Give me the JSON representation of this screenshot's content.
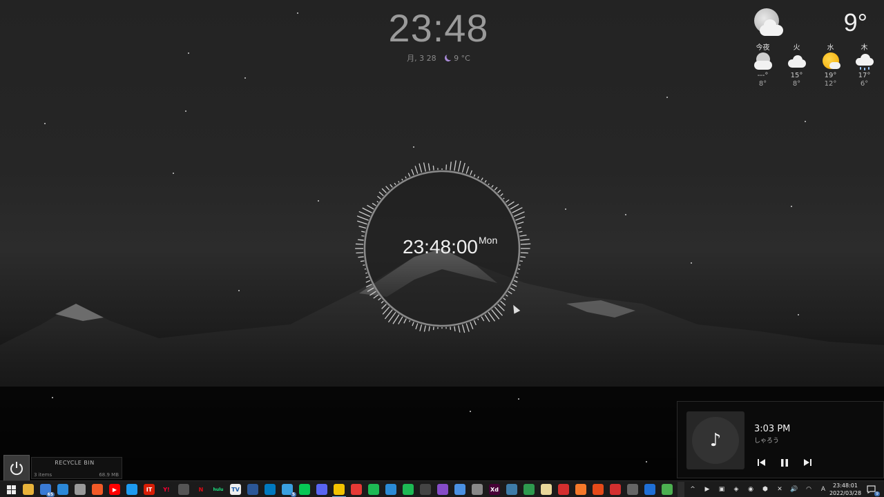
{
  "top_clock": {
    "time": "23:48",
    "date": "月, 3 28",
    "weather": "9 °C"
  },
  "weather": {
    "current_temp": "9°",
    "current_icon": "night-cloud-icon",
    "days": [
      {
        "label": "今夜",
        "icon": "night-cloud-icon",
        "hi": "---°",
        "lo": "8°"
      },
      {
        "label": "火",
        "icon": "cloud-icon",
        "hi": "15°",
        "lo": "8°"
      },
      {
        "label": "水",
        "icon": "sun-cloud-icon",
        "hi": "19°",
        "lo": "12°"
      },
      {
        "label": "木",
        "icon": "rain-cloud-icon",
        "hi": "17°",
        "lo": "6°"
      }
    ]
  },
  "visualizer": {
    "time": "23:48:00",
    "day": "Mon"
  },
  "player": {
    "time": "3:03 PM",
    "artist": "しゃろう",
    "art_icon": "music-note-icon"
  },
  "recycle_bin": {
    "title": "RECYCLE BIN",
    "items": "3 items",
    "size": "68.9 MB"
  },
  "taskbar": {
    "apps": [
      {
        "name": "start-icon",
        "color": "#1b1b1b",
        "glyph": "⊞"
      },
      {
        "name": "file-explorer-icon",
        "color": "#e8b33a",
        "glyph": ""
      },
      {
        "name": "mail-icon",
        "color": "#3a7bd5",
        "glyph": "",
        "badge": "65"
      },
      {
        "name": "store-icon",
        "color": "#2b88d8",
        "glyph": ""
      },
      {
        "name": "folder-icon",
        "color": "#9a9a9a",
        "glyph": ""
      },
      {
        "name": "brave-icon",
        "color": "#f25a27",
        "glyph": ""
      },
      {
        "name": "youtube-icon",
        "color": "#ff0000",
        "glyph": "▶"
      },
      {
        "name": "twitter-icon",
        "color": "#1d9bf0",
        "glyph": ""
      },
      {
        "name": "itmedia-icon",
        "color": "#d81e05",
        "glyph": "IT"
      },
      {
        "name": "yahoo-icon",
        "color": "#1b1b1b",
        "glyph": "Y!"
      },
      {
        "name": "nicovideo-icon",
        "color": "#555555",
        "glyph": ""
      },
      {
        "name": "netflix-icon",
        "color": "#1b1b1b",
        "glyph": "N"
      },
      {
        "name": "hulu-icon",
        "color": "#1b1b1b",
        "glyph": "hulu"
      },
      {
        "name": "tver-icon",
        "color": "#eeeeee",
        "glyph": "TV"
      },
      {
        "name": "code-app-icon",
        "color": "#2b5797",
        "glyph": ""
      },
      {
        "name": "trello-icon",
        "color": "#0079bf",
        "glyph": ""
      },
      {
        "name": "notes-app-icon",
        "color": "#3aa0e0",
        "glyph": "",
        "badge": "5"
      },
      {
        "name": "line-icon",
        "color": "#06c755",
        "glyph": ""
      },
      {
        "name": "discord-icon",
        "color": "#5865f2",
        "glyph": ""
      },
      {
        "name": "chrome-canary-icon",
        "color": "#f2c200",
        "glyph": "",
        "active": true
      },
      {
        "name": "media-app-icon",
        "color": "#e53935",
        "glyph": ""
      },
      {
        "name": "spotify-icon",
        "color": "#1db954",
        "glyph": ""
      },
      {
        "name": "maps-app-icon",
        "color": "#2a8bd6",
        "glyph": ""
      },
      {
        "name": "spotify-alt-icon",
        "color": "#1db954",
        "glyph": ""
      },
      {
        "name": "github-icon",
        "color": "#444444",
        "glyph": ""
      },
      {
        "name": "visual-studio-icon",
        "color": "#854cc7",
        "glyph": ""
      },
      {
        "name": "cloud-app-icon",
        "color": "#4a90e2",
        "glyph": ""
      },
      {
        "name": "tool-app-icon",
        "color": "#888888",
        "glyph": ""
      },
      {
        "name": "adobe-xd-icon",
        "color": "#470137",
        "glyph": "Xd"
      },
      {
        "name": "image-app-icon",
        "color": "#3e7ca8",
        "glyph": ""
      },
      {
        "name": "green-app-icon",
        "color": "#2e9a4e",
        "glyph": ""
      },
      {
        "name": "document-app-icon",
        "color": "#e8d79a",
        "glyph": ""
      },
      {
        "name": "stop-app-icon",
        "color": "#d32f2f",
        "glyph": ""
      },
      {
        "name": "blender-icon",
        "color": "#f5792a",
        "glyph": ""
      },
      {
        "name": "office-icon",
        "color": "#e64a19",
        "glyph": ""
      },
      {
        "name": "power-app-icon",
        "color": "#d32f2f",
        "glyph": ""
      },
      {
        "name": "film-app-icon",
        "color": "#666666",
        "glyph": ""
      },
      {
        "name": "edge-icon",
        "color": "#1f6fd6",
        "glyph": ""
      },
      {
        "name": "green-shield-icon",
        "color": "#4caf50",
        "glyph": ""
      }
    ],
    "tray": [
      {
        "name": "tray-expand-icon",
        "glyph": "^"
      },
      {
        "name": "tray-play-icon",
        "glyph": "▶"
      },
      {
        "name": "tray-app1-icon",
        "glyph": "▣"
      },
      {
        "name": "tray-app2-icon",
        "glyph": "◈"
      },
      {
        "name": "tray-app3-icon",
        "glyph": "◉"
      },
      {
        "name": "tray-app4-icon",
        "glyph": "⬢"
      },
      {
        "name": "tray-app5-icon",
        "glyph": "✕"
      },
      {
        "name": "volume-icon",
        "glyph": "🔊"
      },
      {
        "name": "wifi-icon",
        "glyph": "◠"
      },
      {
        "name": "ime-icon",
        "glyph": "A"
      }
    ],
    "clock_time": "23:48:01",
    "clock_date": "2022/03/28",
    "notification_count": "9"
  }
}
